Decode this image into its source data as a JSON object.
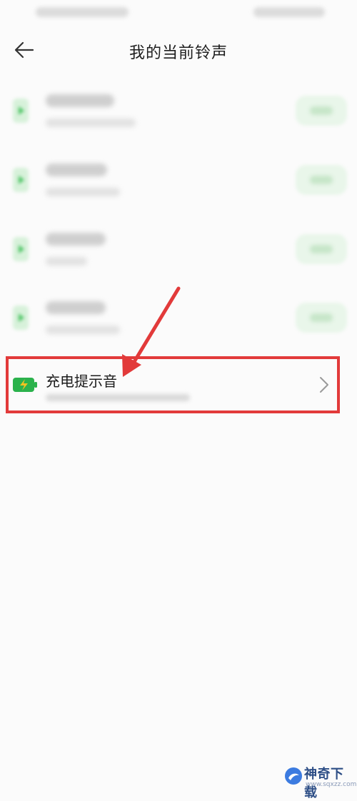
{
  "header": {
    "title": "我的当前铃声"
  },
  "highlighted_item": {
    "title": "充电提示音"
  },
  "watermark": {
    "name": "神奇下载",
    "url": "www.sqxzz.com"
  },
  "colors": {
    "accent_green": "#3fbf5a",
    "highlight_red": "#e23a3a"
  }
}
